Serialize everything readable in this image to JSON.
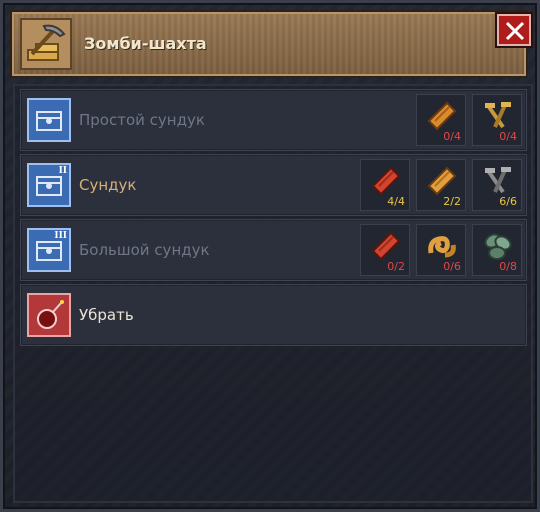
{
  "window": {
    "title": "Зомби-шахта",
    "icons": {
      "title": "pickaxe-on-gold-icon",
      "close": "close-x-icon"
    }
  },
  "colors": {
    "header": "#8a6b49",
    "close": "#b01c1c",
    "count_insufficient": "#e04848",
    "count_sufficient": "#e8c74a"
  },
  "rows": [
    {
      "label": "Простой сундук",
      "icon": "chest-blueprint-icon",
      "tier": "",
      "resources": [
        {
          "icon": "wooden-plank-icon",
          "count": "0/4"
        },
        {
          "icon": "nails-icon",
          "count": "0/4"
        }
      ]
    },
    {
      "label": "Сундук",
      "icon": "chest-blueprint-icon",
      "tier": "II",
      "resources": [
        {
          "icon": "red-plank-icon",
          "count": "4/4"
        },
        {
          "icon": "wooden-plank-icon",
          "count": "2/2"
        },
        {
          "icon": "nails-icon",
          "count": "6/6"
        }
      ]
    },
    {
      "label": "Большой сундук",
      "icon": "chest-blueprint-icon",
      "tier": "III",
      "resources": [
        {
          "icon": "red-plank-icon",
          "count": "0/2"
        },
        {
          "icon": "rope-coil-icon",
          "count": "0/6"
        },
        {
          "icon": "herb-leaves-icon",
          "count": "0/8"
        }
      ]
    },
    {
      "label": "Убрать",
      "icon": "remove-bomb-icon",
      "tier": "",
      "resources": []
    }
  ]
}
